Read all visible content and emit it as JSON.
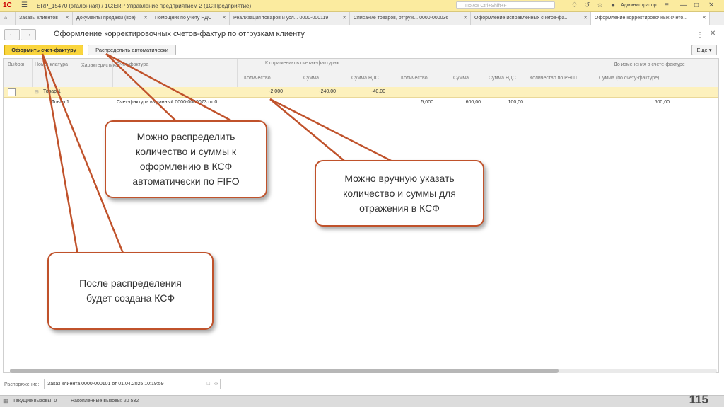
{
  "titlebar": {
    "logo": "1С",
    "title": "ERP_15470 (эталонная) / 1С:ERP Управление предприятием 2  (1С:Предприятие)",
    "search_placeholder": "Поиск Ctrl+Shift+F",
    "user": "Администратор"
  },
  "tabs": [
    {
      "label": "Заказы клиентов"
    },
    {
      "label": "Документы продажи (все)"
    },
    {
      "label": "Помощник по учету НДС"
    },
    {
      "label": "Реализация товаров и усл... 0000-000119"
    },
    {
      "label": "Списание товаров, отгруж... 0000-000036"
    },
    {
      "label": "Оформление исправленных счетов-фа..."
    },
    {
      "label": "Оформление корректировочных счето..."
    }
  ],
  "form": {
    "title": "Оформление корректировочных счетов-фактур по отгрузкам клиенту",
    "btn_primary": "Оформить счет-фактуру",
    "btn_auto": "Распределить автоматически",
    "btn_more": "Еще"
  },
  "table": {
    "headers": {
      "selected": "Выбран",
      "nomenclature": "Номенклатура",
      "characteristic": "Характеристика",
      "invoice": "Счет-фактура",
      "group_reflect": "К отражению в счетах-фактурах",
      "group_before": "До изменения в счете-фактуре",
      "qty": "Количество",
      "sum": "Сумма",
      "vat": "Сумма НДС",
      "qty2": "Количество",
      "sum2": "Сумма",
      "vat2": "Сумма НДС",
      "qty_rnpt": "Количество по РНПТ",
      "sum_invoice": "Сумма (по счету-фактуре)"
    },
    "rows": [
      {
        "nomenclature": "Товар 1",
        "invoice": "",
        "qty": "-2,000",
        "sum": "-240,00",
        "vat": "-40,00",
        "qty2": "",
        "sum2": "",
        "vat2": "",
        "sum_invoice": ""
      },
      {
        "nomenclature": "Товар 1",
        "invoice": "Счет-фактура выданный 0000-0000073 от 0...",
        "qty": "",
        "sum": "",
        "vat": "",
        "qty2": "5,000",
        "sum2": "600,00",
        "vat2": "100,00",
        "sum_invoice": "600,00"
      }
    ]
  },
  "footer": {
    "label": "Распоряжение:",
    "value": "Заказ клиента 0000-000101 от 01.04.2025 10:19:59"
  },
  "status": {
    "current_calls": "Текущие вызовы: 0",
    "accumulated_calls": "Накопленные вызовы: 20 532"
  },
  "page_number": "115",
  "callouts": {
    "fifo": "Можно распределить количество и суммы к оформлению в КСФ автоматически по FIFO",
    "manual": "Можно вручную указать количество и суммы для отражения в КСФ",
    "after": "После распределения будет создана КСФ"
  },
  "colors": {
    "accent": "#fad53d",
    "callout_border": "#c0522b",
    "titlebar": "#fbeb9f"
  }
}
